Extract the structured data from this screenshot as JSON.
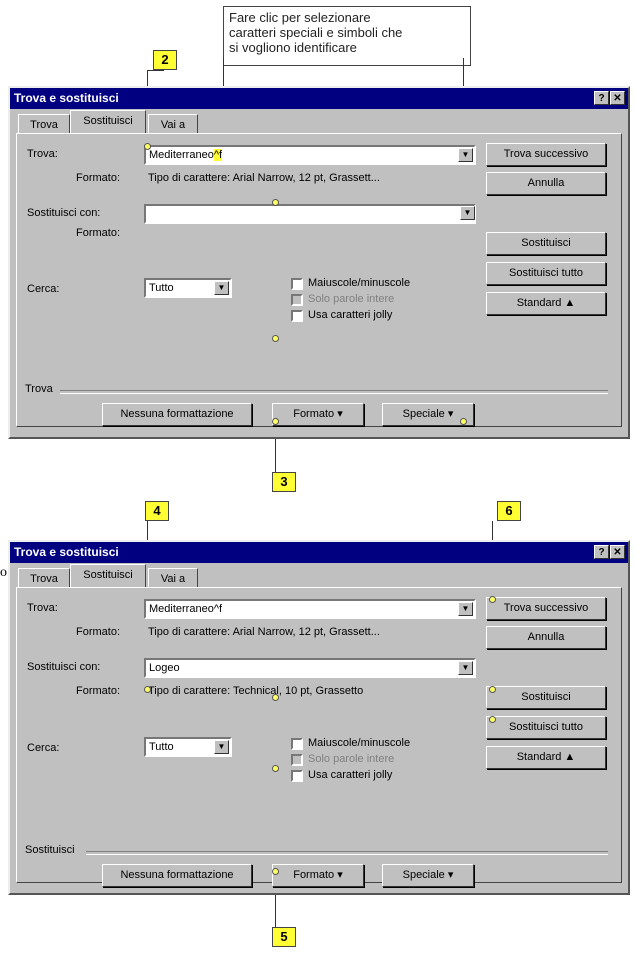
{
  "top_callout": {
    "lines": [
      "Fare clic per selezionare",
      "caratteri speciali e simboli che",
      "si vogliono identificare"
    ]
  },
  "markers": [
    "2",
    "3",
    "4",
    "5",
    "6"
  ],
  "stray_char": "o",
  "dialog1": {
    "title": "Trova e sostituisci",
    "tabs": [
      "Trova",
      "Sostituisci",
      "Vai a"
    ],
    "find_label": "Trova:",
    "find_value": "Mediterraneo^f",
    "find_value_plain": "Mediterraneo",
    "find_value_code": "^f",
    "format_label": "Formato:",
    "format_value": "Tipo di carattere: Arial Narrow, 12 pt, Grassett...",
    "replace_label": "Sostituisci con:",
    "replace_value": "",
    "replace_format_label": "Formato:",
    "replace_format_value": "",
    "search_label": "Cerca:",
    "search_value": "Tutto",
    "opt_case": "Maiuscole/minuscole",
    "opt_whole": "Solo parole intere",
    "opt_wild": "Usa caratteri jolly",
    "section_label": "Trova",
    "btn_no_format": "Nessuna formattazione",
    "btn_format": "Formato ▾",
    "btn_special": "Speciale ▾",
    "btn_find_next": "Trova successivo",
    "btn_cancel": "Annulla",
    "btn_replace": "Sostituisci",
    "btn_replace_all": "Sostituisci tutto",
    "btn_standard": "Standard ▲"
  },
  "dialog2": {
    "title": "Trova e sostituisci",
    "tabs": [
      "Trova",
      "Sostituisci",
      "Vai a"
    ],
    "find_label": "Trova:",
    "find_value": "Mediterraneo^f",
    "format_label": "Formato:",
    "format_value": "Tipo di carattere: Arial Narrow, 12 pt, Grassett...",
    "replace_label": "Sostituisci con:",
    "replace_value": "Logeo",
    "replace_format_label": "Formato:",
    "replace_format_value": "Tipo di carattere: Technical, 10 pt, Grassetto",
    "search_label": "Cerca:",
    "search_value": "Tutto",
    "opt_case": "Maiuscole/minuscole",
    "opt_whole": "Solo parole intere",
    "opt_wild": "Usa caratteri jolly",
    "section_label": "Sostituisci",
    "btn_no_format": "Nessuna formattazione",
    "btn_format": "Formato ▾",
    "btn_special": "Speciale ▾",
    "btn_find_next": "Trova successivo",
    "btn_cancel": "Annulla",
    "btn_replace": "Sostituisci",
    "btn_replace_all": "Sostituisci tutto",
    "btn_standard": "Standard ▲"
  },
  "titlebar_buttons": {
    "help": "?",
    "close": "✕"
  },
  "colors": {
    "titlebar": "#000080",
    "dialog": "#c0c0c0",
    "marker": "#ffff33"
  }
}
